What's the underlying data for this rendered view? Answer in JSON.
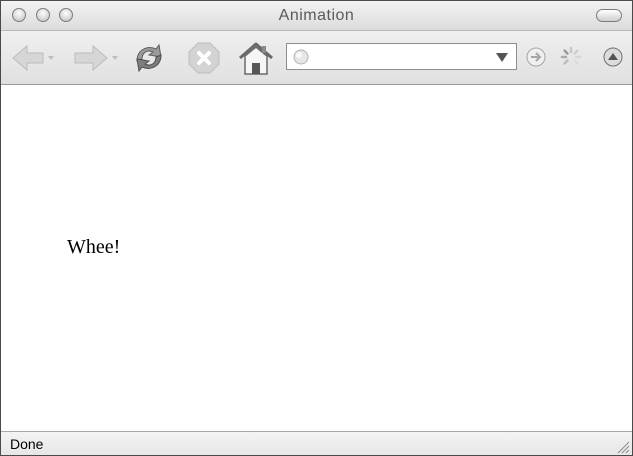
{
  "window": {
    "title": "Animation"
  },
  "toolbar": {
    "buttons": [
      {
        "name": "back",
        "icon": "back-arrow-icon"
      },
      {
        "name": "forward",
        "icon": "forward-arrow-icon"
      },
      {
        "name": "reload",
        "icon": "reload-icon"
      },
      {
        "name": "stop",
        "icon": "stop-icon"
      },
      {
        "name": "home",
        "icon": "home-icon"
      },
      {
        "name": "go",
        "icon": "go-icon"
      },
      {
        "name": "activity",
        "icon": "throbber-icon"
      },
      {
        "name": "menu",
        "icon": "arrow-up-circle-icon"
      }
    ]
  },
  "addressbar": {
    "value": "",
    "placeholder": ""
  },
  "page": {
    "text": "Whee!"
  },
  "statusbar": {
    "text": "Done"
  }
}
